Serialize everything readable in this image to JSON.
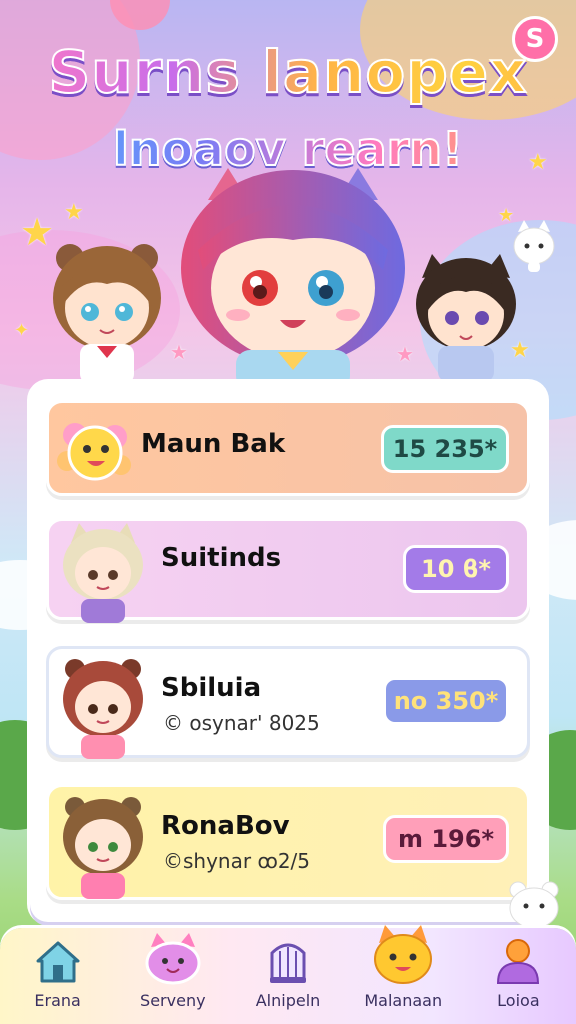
{
  "header": {
    "title": "Surns lanopex",
    "subtitle": "lnoaov rearn!",
    "corner_badge": "S"
  },
  "leaderboard": [
    {
      "name": "Maun Bak",
      "score": "15 235*",
      "colors": {
        "row": "#fbc49a",
        "badge": "#7fd9c9"
      }
    },
    {
      "name": "Suitinds",
      "score": "10 ϐ*",
      "colors": {
        "row": "#f0c8ef",
        "badge": "#a37be8"
      }
    },
    {
      "name": "Sbiluia",
      "sub": "© osynar' 8025",
      "score": "no 350*",
      "colors": {
        "row": "#ffffff",
        "badge": "#8a9ae8"
      }
    },
    {
      "name": "RonaBov",
      "sub": "©shynar ꝏ2/5",
      "score": "m 196*",
      "colors": {
        "row": "#fff2a8",
        "badge": "#ff9fb9"
      }
    }
  ],
  "nav": [
    {
      "label": "Erana",
      "icon": "home-icon"
    },
    {
      "label": "Serveny",
      "icon": "pet-icon"
    },
    {
      "label": "Alnipeln",
      "icon": "cage-icon"
    },
    {
      "label": "Malanaan",
      "icon": "cat-mascot-icon"
    },
    {
      "label": "Loioa",
      "icon": "profile-icon"
    }
  ]
}
